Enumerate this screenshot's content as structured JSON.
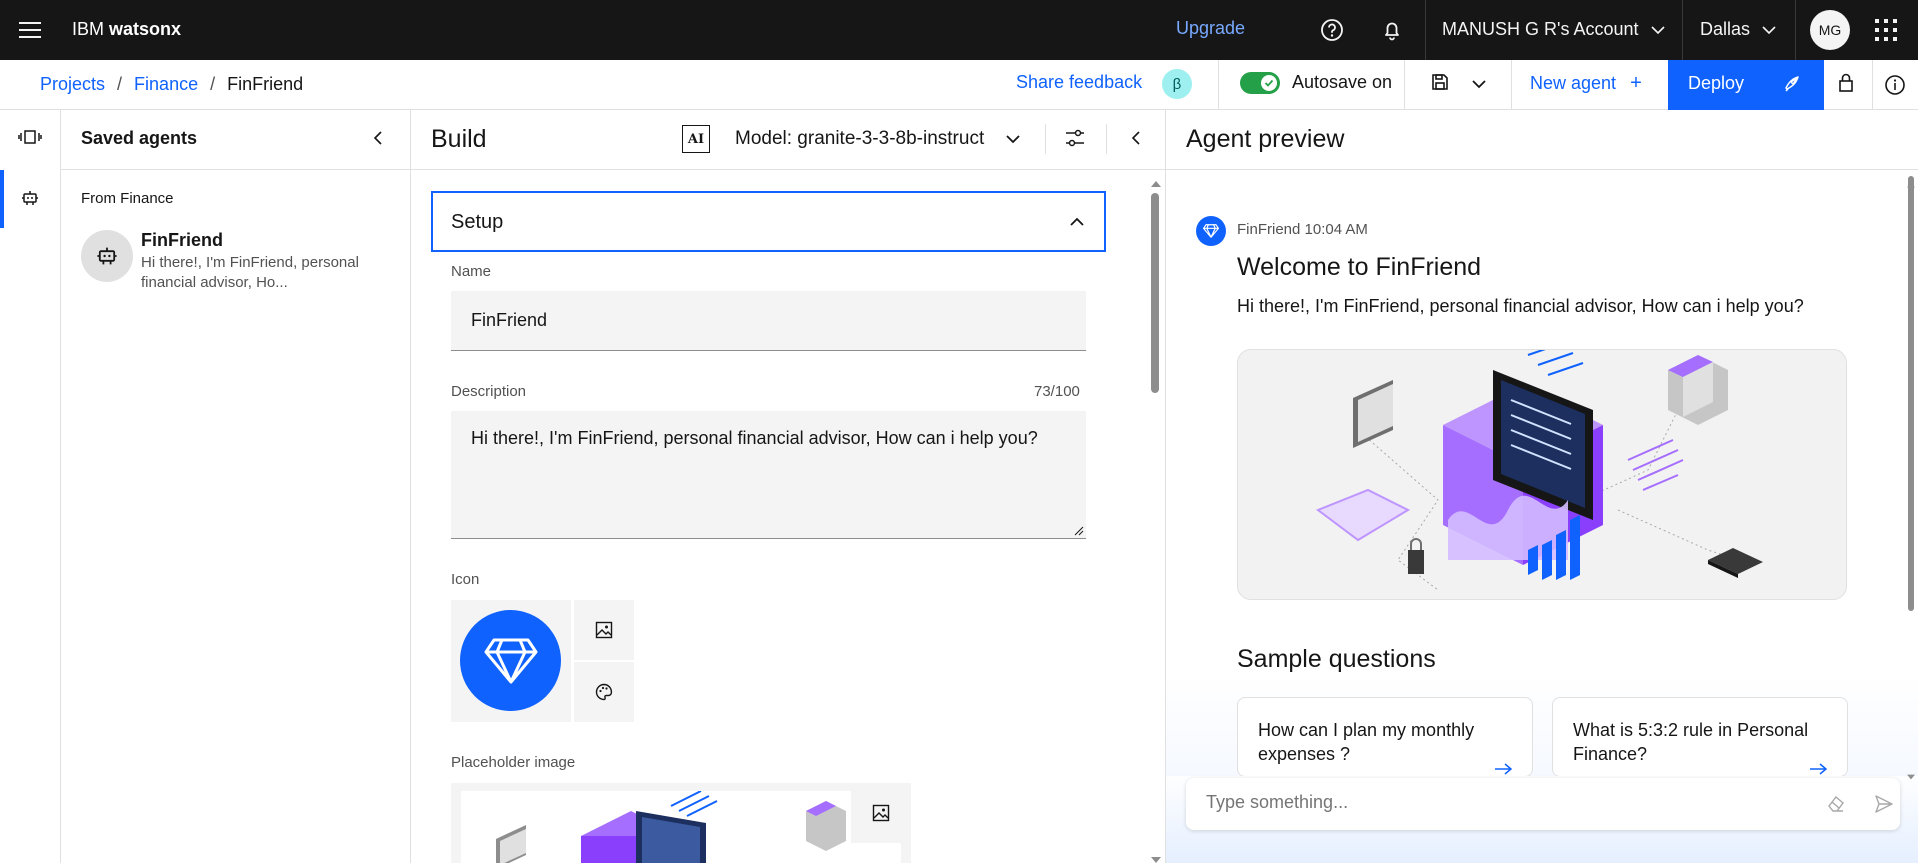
{
  "topbar": {
    "brand_prefix": "IBM ",
    "brand_name": "watsonx",
    "upgrade": "Upgrade",
    "account": "MANUSH G R's Account",
    "region": "Dallas",
    "avatar_initials": "MG"
  },
  "subbar": {
    "breadcrumbs": [
      "Projects",
      "Finance",
      "FinFriend"
    ],
    "separator": "/",
    "share_feedback": "Share feedback",
    "beta": "β",
    "autosave": "Autosave on",
    "new_agent": "New agent",
    "new_agent_plus": "+",
    "deploy": "Deploy"
  },
  "saved": {
    "title": "Saved agents",
    "group": "From Finance",
    "agent_name": "FinFriend",
    "agent_desc": "Hi there!, I'm FinFriend, personal financial advisor, Ho..."
  },
  "build": {
    "title": "Build",
    "ai_badge": "AI",
    "model": "Model: granite-3-3-8b-instruct",
    "setup": "Setup",
    "name_label": "Name",
    "name_value": "FinFriend",
    "description_label": "Description",
    "description_count": "73/100",
    "description_value": "Hi there!, I'm FinFriend, personal financial advisor, How can i help you?",
    "icon_label": "Icon",
    "placeholder_label": "Placeholder image"
  },
  "preview": {
    "title": "Agent preview",
    "bot_name": "FinFriend",
    "time": "10:04 AM",
    "welcome": "Welcome to FinFriend",
    "greeting": "Hi there!, I'm FinFriend, personal financial advisor, How can i help you?",
    "sample_title": "Sample questions",
    "questions": [
      {
        "text": "How can I plan my monthly expenses ?"
      },
      {
        "text": "What is 5:3:2 rule in Personal Finance?"
      }
    ],
    "input_placeholder": "Type something..."
  },
  "colors": {
    "accent": "#0f62fe",
    "topbar_bg": "#161616",
    "toggle_on": "#24a148"
  }
}
